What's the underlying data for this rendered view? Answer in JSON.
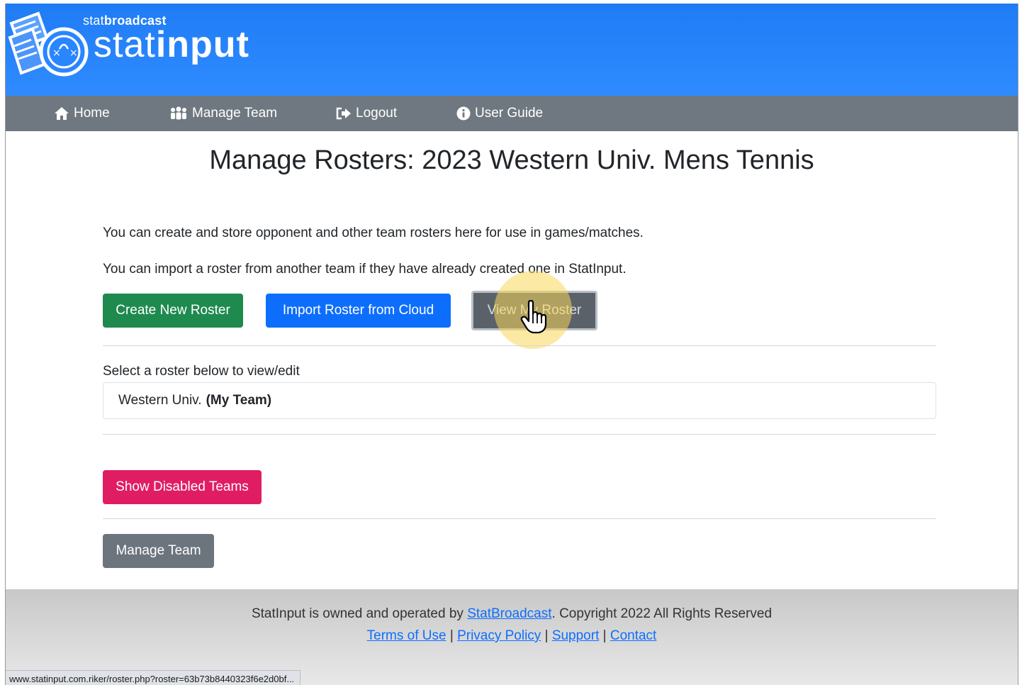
{
  "brand": {
    "small_prefix": "stat",
    "small_bold": "broadcast",
    "big_light": "stat",
    "big_bold": "input"
  },
  "nav": [
    {
      "label": "Home",
      "icon": "home-icon"
    },
    {
      "label": "Manage Team",
      "icon": "users-icon"
    },
    {
      "label": "Logout",
      "icon": "logout-icon"
    },
    {
      "label": "User Guide",
      "icon": "info-icon"
    }
  ],
  "page": {
    "title": "Manage Rosters: 2023 Western Univ. Mens Tennis",
    "intro1": "You can create and store opponent and other team rosters here for use in games/matches.",
    "intro2": "You can import a roster from another team if they have already created one in StatInput."
  },
  "buttons": {
    "create": "Create New Roster",
    "import": "Import Roster from Cloud",
    "view": "View My Roster",
    "show_disabled": "Show Disabled Teams",
    "manage_team": "Manage Team"
  },
  "roster_select": {
    "label": "Select a roster below to view/edit",
    "items": [
      {
        "name": "Western Univ.",
        "tag": "(My Team)"
      }
    ]
  },
  "footer": {
    "text_prefix": "StatInput is owned and operated by ",
    "link_statbroadcast": "StatBroadcast",
    "text_suffix": ". Copyright 2022 All Rights Reserved",
    "links": [
      "Terms of Use",
      "Privacy Policy",
      "Support",
      "Contact"
    ],
    "separator": " | "
  },
  "status_url": "www.statinput.com.riker/roster.php?roster=63b73b8440323f6e2d0bf...",
  "colors": {
    "banner": "#2f8bff",
    "navbar": "#6f7880",
    "create": "#1e8a4e",
    "import": "#0d6efd",
    "show_disabled": "#e01d63",
    "manage_team": "#6c757d"
  }
}
